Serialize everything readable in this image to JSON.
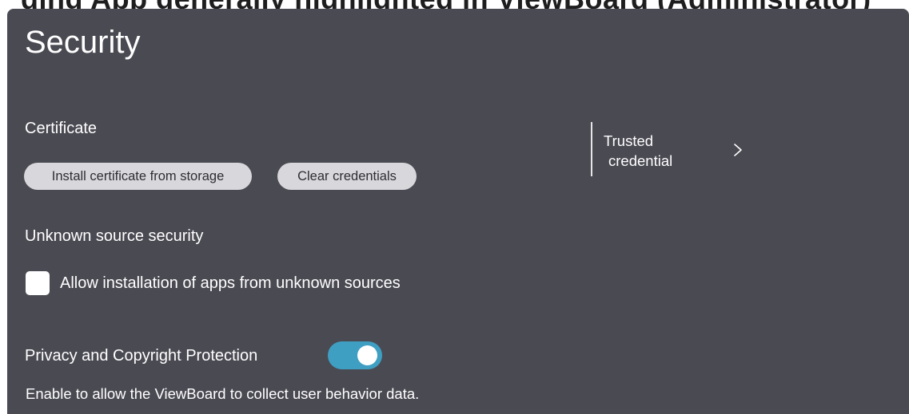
{
  "top_heading_fragment": "ding App generally highlighted in ViewBoard (Administrator)",
  "page": {
    "title": "Security"
  },
  "certificate": {
    "label": "Certificate",
    "install_button": "Install certificate from storage",
    "clear_button": "Clear credentials"
  },
  "trusted_credential": {
    "line1": "Trusted",
    "line2": "credential",
    "icon": "chevron-right-icon"
  },
  "unknown_source": {
    "label": "Unknown source security",
    "checkbox_label": "Allow installation of apps from unknown sources",
    "checked": false
  },
  "privacy": {
    "label": "Privacy and Copyright Protection",
    "toggle_on": true,
    "description": "Enable to allow the ViewBoard to collect user behavior data."
  },
  "colors": {
    "panel_bg": "#4a4a53",
    "button_bg": "#d8d8dc",
    "toggle_on": "#3f9fc2",
    "text": "#ffffff"
  }
}
